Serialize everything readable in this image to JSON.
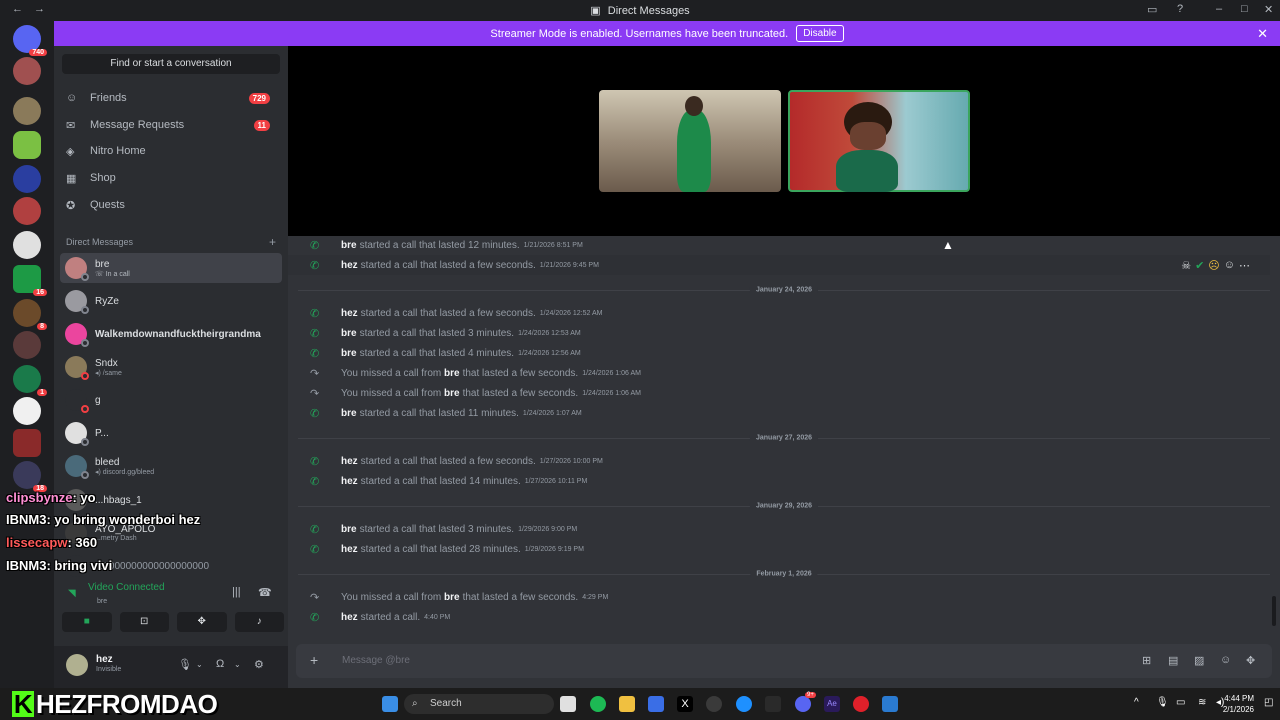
{
  "window": {
    "title": "Direct Messages",
    "title_icon": "discord-icon"
  },
  "banner": {
    "text": "Streamer Mode is enabled. Usernames have been truncated.",
    "disable_label": "Disable"
  },
  "guilds": {
    "home_badge": "740",
    "badges": [
      "16",
      "8",
      "1",
      "18"
    ]
  },
  "sidebar": {
    "search_label": "Find or start a conversation",
    "nav": [
      {
        "label": "Friends",
        "badge": "729",
        "icon": "friends-icon"
      },
      {
        "label": "Message Requests",
        "badge": "11",
        "icon": "envelope-icon"
      },
      {
        "label": "Nitro Home",
        "badge": "",
        "icon": "nitro-icon"
      },
      {
        "label": "Shop",
        "badge": "",
        "icon": "shop-icon"
      },
      {
        "label": "Quests",
        "badge": "",
        "icon": "quests-icon"
      }
    ],
    "dm_header": "Direct Messages",
    "dms": [
      {
        "name": "bre",
        "sub": "In a call"
      },
      {
        "name": "RyZe",
        "sub": ""
      },
      {
        "name": "Walkemdownandfucktheirgrandma",
        "sub": ""
      },
      {
        "name": "Sndx",
        "sub": "/same"
      },
      {
        "name": "g",
        "sub": ""
      },
      {
        "name": "P...",
        "sub": ""
      },
      {
        "name": "bleed",
        "sub": "discord.gg/bleed"
      },
      {
        "name": "...hbags_1",
        "sub": ""
      },
      {
        "name": "AYO_APOLO",
        "sub": "...metry Dash"
      },
      {
        "name": "...0000000000000000000",
        "sub": ""
      }
    ],
    "voice": {
      "status": "Video Connected",
      "channel": "bre"
    },
    "user": {
      "name": "hez",
      "status": "Invisible"
    }
  },
  "stream_chat": [
    {
      "name": "clipsbynze",
      "text": ": yo"
    },
    {
      "name": "IBNM3",
      "text": ": yo bring wonderboi hez"
    },
    {
      "name": "lissecapw",
      "text": ": 360"
    },
    {
      "name": "IBNM3",
      "text": ": bring vivi"
    }
  ],
  "messages": [
    {
      "who": "bre",
      "text": "started a call that lasted 12 minutes.",
      "ts": "1/21/2026 8:51 PM",
      "missed": false
    },
    {
      "who": "hez",
      "text": "started a call that lasted a few seconds.",
      "ts": "1/21/2026 9:45 PM",
      "missed": false
    },
    {
      "divider": "January 24, 2026"
    },
    {
      "who": "hez",
      "text": "started a call that lasted a few seconds.",
      "ts": "1/24/2026 12:52 AM",
      "missed": false
    },
    {
      "who": "bre",
      "text": "started a call that lasted 3 minutes.",
      "ts": "1/24/2026 12:53 AM",
      "missed": false
    },
    {
      "who": "bre",
      "text": "started a call that lasted 4 minutes.",
      "ts": "1/24/2026 12:56 AM",
      "missed": false
    },
    {
      "who": "bre",
      "prefix": "You missed a call from",
      "text": "that lasted a few seconds.",
      "ts": "1/24/2026 1:06 AM",
      "missed": true
    },
    {
      "who": "bre",
      "prefix": "You missed a call from",
      "text": "that lasted a few seconds.",
      "ts": "1/24/2026 1:06 AM",
      "missed": true
    },
    {
      "who": "bre",
      "text": "started a call that lasted 11 minutes.",
      "ts": "1/24/2026 1:07 AM",
      "missed": false
    },
    {
      "divider": "January 27, 2026"
    },
    {
      "who": "hez",
      "text": "started a call that lasted a few seconds.",
      "ts": "1/27/2026 10:00 PM",
      "missed": false
    },
    {
      "who": "hez",
      "text": "started a call that lasted 14 minutes.",
      "ts": "1/27/2026 10:11 PM",
      "missed": false
    },
    {
      "divider": "January 29, 2026"
    },
    {
      "who": "bre",
      "text": "started a call that lasted 3 minutes.",
      "ts": "1/29/2026 9:00 PM",
      "missed": false
    },
    {
      "who": "hez",
      "text": "started a call that lasted 28 minutes.",
      "ts": "1/29/2026 9:19 PM",
      "missed": false
    },
    {
      "divider": "February 1, 2026"
    },
    {
      "who": "bre",
      "prefix": "You missed a call from",
      "text": "that lasted a few seconds.",
      "ts": "4:29 PM",
      "missed": true
    },
    {
      "who": "hez",
      "text": "started a call.",
      "ts": "4:40 PM",
      "missed": false
    }
  ],
  "composer": {
    "placeholder": "Message @bre"
  },
  "overlay_brand": {
    "text": "HEZFROMDAO",
    "logo": "K"
  },
  "taskbar": {
    "search": "Search",
    "time": "4:44 PM",
    "date": "2/1/2026",
    "discord_badge": "9+"
  }
}
